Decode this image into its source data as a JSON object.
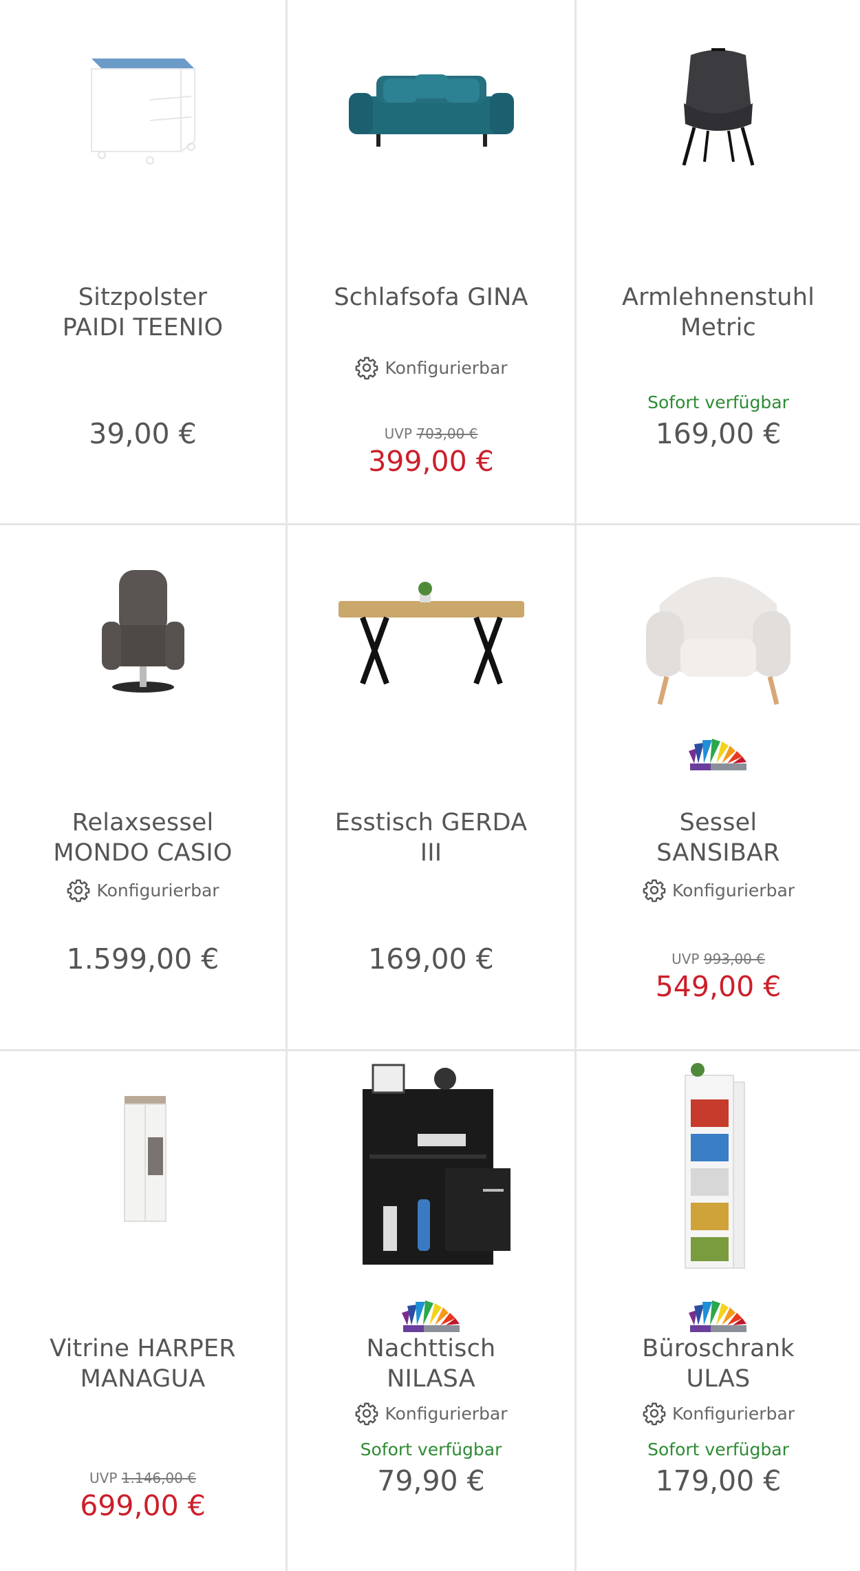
{
  "common": {
    "configurable_label": "Konfigurierbar",
    "available_label": "Sofort verfügbar",
    "uvp_prefix": "UVP"
  },
  "products": [
    {
      "name_line1": "Sitzpolster",
      "name_line2": "PAIDI TEENIO",
      "price": "39,00 €",
      "image_icon": "drawer-cushion-image"
    },
    {
      "name_line1": "Schlafsofa GINA",
      "name_line2": "",
      "uvp": "703,00 €",
      "price": "399,00 €",
      "configurable": true,
      "image_icon": "sofa-image"
    },
    {
      "name_line1": "Armlehnenstuhl",
      "name_line2": "Metric",
      "available": true,
      "price": "169,00 €",
      "image_icon": "chair-image"
    },
    {
      "name_line1": "Relaxsessel",
      "name_line2": "MONDO CASIO",
      "configurable": true,
      "price": "1.599,00 €",
      "image_icon": "recliner-image"
    },
    {
      "name_line1": "Esstisch GERDA",
      "name_line2": "III",
      "price": "169,00 €",
      "image_icon": "table-image"
    },
    {
      "name_line1": "Sessel",
      "name_line2": "SANSIBAR",
      "configurable": true,
      "uvp": "993,00 €",
      "price": "549,00 €",
      "color_swatch": true,
      "image_icon": "armchair-image"
    },
    {
      "name_line1": "Vitrine HARPER",
      "name_line2": "MANAGUA",
      "uvp": "1.146,00 €",
      "price": "699,00 €",
      "image_icon": "vitrine-image"
    },
    {
      "name_line1": "Nachttisch",
      "name_line2": "NILASA",
      "configurable": true,
      "available": true,
      "price": "79,90 €",
      "color_swatch": true,
      "image_icon": "nightstand-image"
    },
    {
      "name_line1": "Büroschrank",
      "name_line2": "ULAS",
      "configurable": true,
      "available": true,
      "price": "179,00 €",
      "color_swatch": true,
      "image_icon": "office-cabinet-image"
    }
  ],
  "colors": {
    "sale_price": "#cc1f2a",
    "available": "#2e8b34",
    "divider": "#e6e6e6"
  }
}
